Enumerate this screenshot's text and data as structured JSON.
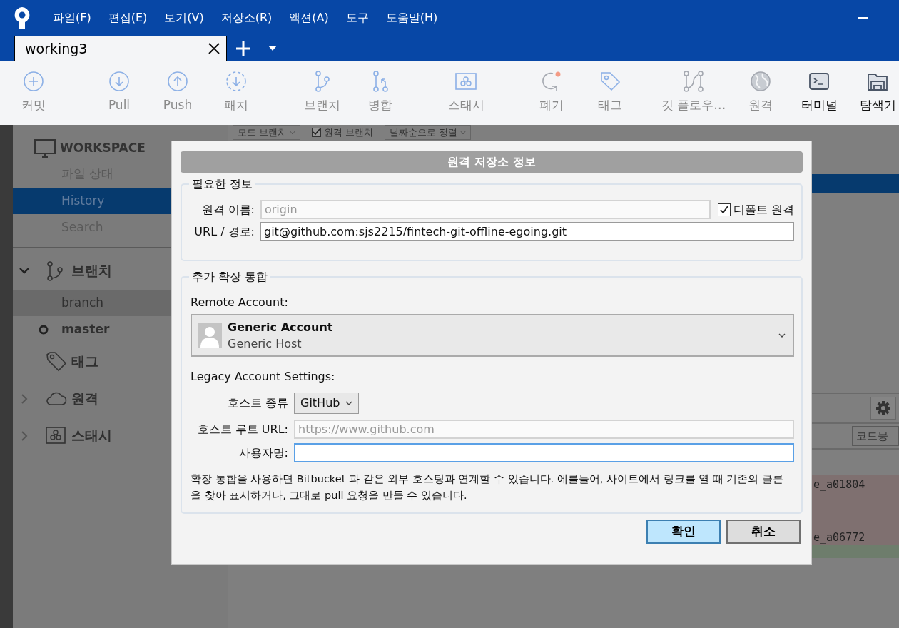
{
  "menu": [
    "파일(F)",
    "편집(E)",
    "보기(V)",
    "저장소(R)",
    "액션(A)",
    "도구",
    "도움말(H)"
  ],
  "tabs": [
    {
      "label": "working3",
      "selected": true
    }
  ],
  "toolbar": [
    [
      {
        "label": "커밋",
        "disabled": true
      }
    ],
    [
      {
        "label": "Pull",
        "disabled": true
      },
      {
        "label": "Push",
        "disabled": true
      },
      {
        "label": "패치",
        "disabled": true
      }
    ],
    [
      {
        "label": "브랜치",
        "disabled": true
      },
      {
        "label": "병합",
        "disabled": true
      }
    ],
    [
      {
        "label": "스태시",
        "disabled": true
      }
    ],
    [
      {
        "label": "폐기",
        "disabled": true
      },
      {
        "label": "태그",
        "disabled": true
      }
    ],
    [
      {
        "label": "깃 플로우…",
        "disabled": true
      },
      {
        "label": "원격",
        "disabled": true
      },
      {
        "label": "터미널",
        "disabled": false
      },
      {
        "label": "탐색기",
        "disabled": false
      }
    ]
  ],
  "sidebar": {
    "workspace": {
      "title": "WORKSPACE",
      "items": [
        {
          "label": "파일 상태",
          "selected": false
        },
        {
          "label": "History",
          "selected": true
        },
        {
          "label": "Search",
          "selected": false
        }
      ]
    },
    "sections": [
      {
        "kind": "group",
        "label": "브랜치",
        "expanded": true,
        "children": [
          {
            "label": "branch",
            "selected": true,
            "current": false
          },
          {
            "label": "master",
            "selected": false,
            "current": true
          }
        ]
      },
      {
        "kind": "leaf",
        "label": "태그"
      },
      {
        "kind": "group",
        "label": "원격",
        "expanded": false
      },
      {
        "kind": "group",
        "label": "스태시",
        "expanded": false
      }
    ]
  },
  "filter_bar": [
    {
      "kind": "dropdown",
      "label": "모드 브랜치"
    },
    {
      "kind": "checkbox",
      "label": "원격 브랜치",
      "checked": true
    },
    {
      "kind": "dropdown",
      "label": "날짜순으로 정렬"
    }
  ],
  "background": {
    "search_field": "코드뭉",
    "commits": [
      {
        "text": "e_a01804",
        "color": "#7f7070"
      },
      {
        "text": "e_a06772",
        "color": "#7f7070"
      }
    ]
  },
  "dialog": {
    "title": "원격 저장소 정보",
    "required": {
      "legend": "필요한 정보",
      "remote_name": {
        "label": "원격 이름:",
        "placeholder": "origin"
      },
      "default_remote": {
        "label": "디폴트 원격",
        "checked": true
      },
      "url": {
        "label": "URL / 경로:",
        "value": "git@github.com:sjs2215/fintech-git-offline-egoing.git"
      }
    },
    "integration": {
      "legend": "추가 확장 통합",
      "account_label": "Remote Account:",
      "account": {
        "name": "Generic Account",
        "host": "Generic Host"
      },
      "legacy_label": "Legacy Account Settings:",
      "host_type": {
        "label": "호스트 종류",
        "value": "GitHub"
      },
      "host_root": {
        "label": "호스트 루트 URL:",
        "placeholder": "https://www.github.com"
      },
      "username": {
        "label": "사용자명:",
        "focused": true
      },
      "note": "확장 통합을 사용하면 Bitbucket 과 같은 외부 호스팅과 연계할 수 있습니다. 에를들어, 사이트에서 링크를 열 때 기존의 클론을 찾아 표시하거나, 그대로 pull 요청을 만들 수 있습니다."
    },
    "buttons": [
      {
        "label": "확인",
        "default": true
      },
      {
        "label": "취소",
        "default": false
      }
    ]
  }
}
